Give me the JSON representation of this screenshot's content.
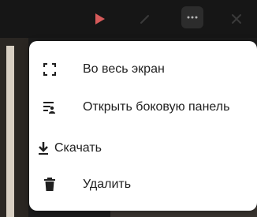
{
  "toolbar": {
    "icons": [
      "play-icon",
      "edit-icon",
      "more-icon",
      "close-icon"
    ],
    "colors": {
      "background": "#161616",
      "play_accent": "#d65a5a",
      "active_button": "#2c2c2c"
    }
  },
  "menu": {
    "items": [
      {
        "label": "Во весь экран",
        "icon": "fullscreen-icon"
      },
      {
        "label": "Открыть боковую панель",
        "icon": "sidebar-icon"
      },
      {
        "label": "Скачать",
        "icon": "download-icon"
      },
      {
        "label": "Удалить",
        "icon": "trash-icon"
      }
    ],
    "colors": {
      "background": "#ffffff",
      "text": "#1f1f1f"
    }
  }
}
